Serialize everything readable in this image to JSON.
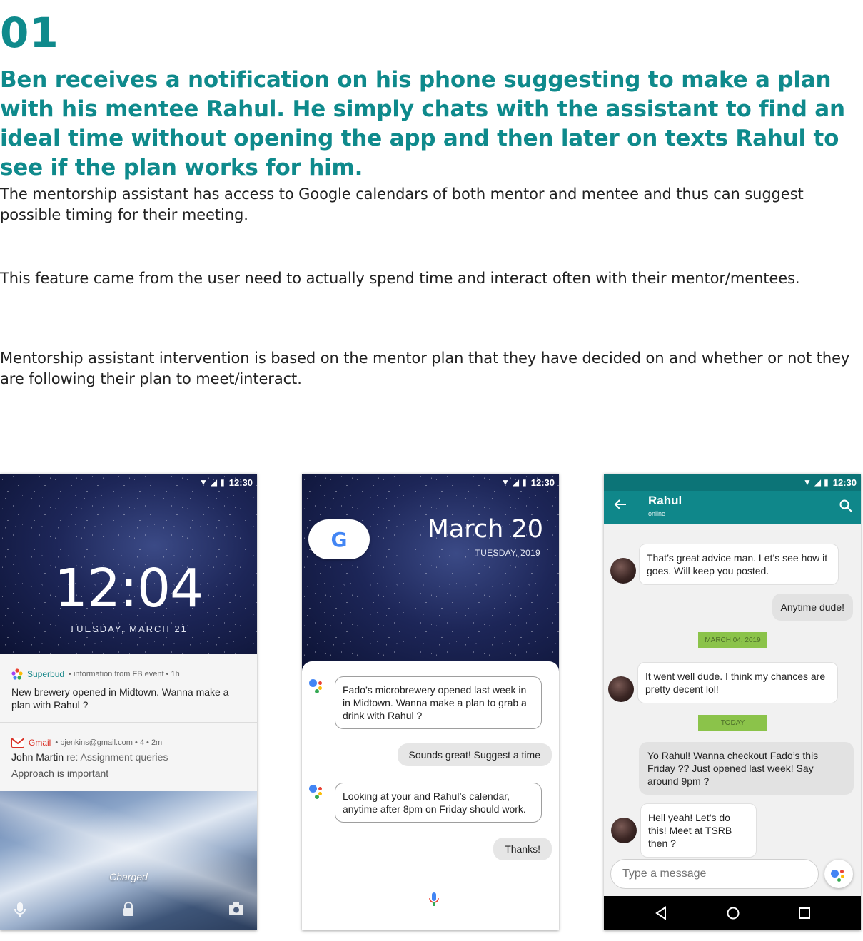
{
  "heading": {
    "number": "01",
    "headline": "Ben receives a notification on his phone suggesting to make a plan with his mentee Rahul. He simply chats with the assistant to find an ideal time without opening the app and then later on texts Rahul to see if the plan works for him."
  },
  "paragraphs": [
    "The mentorship assistant has access to Google calendars of both mentor and mentee and thus can suggest possible timing for their meeting.",
    "This feature came from the user need to actually spend time and interact often with their mentor/mentees.",
    "Mentorship assistant intervention is based on the mentor plan that they have decided on and whether or not they are following their plan to meet/interact."
  ],
  "phone1": {
    "status_time": "12:30",
    "lock_time": "12:04",
    "lock_date": "TUESDAY, MARCH 21",
    "notif1": {
      "app": "Superbud",
      "meta": "• information from FB event  • 1h",
      "body": "New brewery opened in Midtown. Wanna make a plan with Rahul ?"
    },
    "notif2": {
      "app": "Gmail",
      "meta": "• bjenkins@gmail.com • 4 •  2m",
      "sender": "John Martin",
      "subject": "re: Assignment queries",
      "preview": "Approach is important"
    },
    "charged": "Charged"
  },
  "phone2": {
    "status_time": "12:30",
    "google_letter": "G",
    "big_date": "March 20",
    "small_date": "TUESDAY, 2019",
    "messages": {
      "assistant1": "Fado’s microbrewery opened last week in in Midtown. Wanna make a plan to grab a drink with Rahul ?",
      "user1": "Sounds great! Suggest a time",
      "assistant2": "Looking at your and Rahul’s calendar, anytime after 8pm on Friday should work.",
      "user2": "Thanks!"
    }
  },
  "phone3": {
    "status_time": "12:30",
    "contact_name": "Rahul",
    "contact_status": "online",
    "messages": {
      "in1": "That’s great advice man. Let’s see how it goes. Will keep you posted.",
      "out1": "Anytime dude!",
      "date1": "MARCH 04, 2019",
      "in2": "It went well dude. I think my chances are pretty decent lol!",
      "date2": "TODAY",
      "out2": "Yo Rahul! Wanna checkout Fado’s this Friday ?? Just opened last week! Say around 9pm ?",
      "in3": "Hell yeah! Let’s do this! Meet at TSRB then ?"
    },
    "input_placeholder": "Type a message"
  },
  "colors": {
    "accent_teal": "#0f8a8c",
    "date_chip_green": "#8bc34a",
    "google_blue": "#4285f4",
    "google_red": "#ea4335",
    "google_yellow": "#fbbc05",
    "google_green": "#34a853"
  },
  "icons": [
    "wifi-icon",
    "signal-icon",
    "battery-icon",
    "superbud-icon",
    "gmail-icon",
    "mic-icon",
    "lock-icon",
    "camera-icon",
    "google-logo",
    "assistant-icon",
    "back-arrow-icon",
    "search-icon",
    "nav-back-icon",
    "nav-home-icon",
    "nav-recents-icon"
  ]
}
